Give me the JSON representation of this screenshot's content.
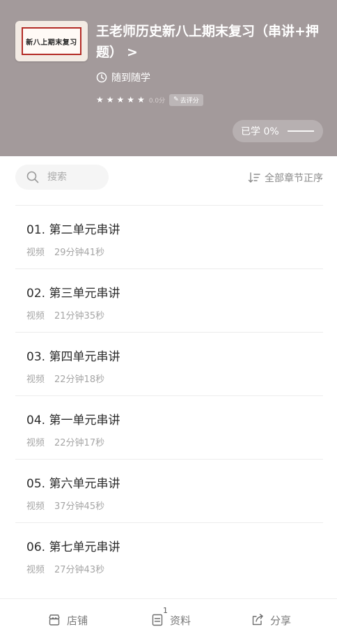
{
  "header": {
    "thumbnail_text": "新八上期末复习",
    "title": "王老师历史新八上期末复习（串讲+押题）",
    "title_chevron": ">",
    "study_mode": "随到随学",
    "rating_text": "0.0分",
    "rate_button": "去评分",
    "progress_label": "已学 0%",
    "progress_value": 0,
    "colors": {
      "header_bg": "#a39a9b",
      "thumb_border": "#b32b25"
    }
  },
  "toolbar": {
    "search_placeholder": "搜索",
    "sort_label": "全部章节正序"
  },
  "chapters": [
    {
      "title": "01. 第二单元串讲",
      "type": "视频",
      "duration": "29分钟41秒"
    },
    {
      "title": "02. 第三单元串讲",
      "type": "视频",
      "duration": "21分钟35秒"
    },
    {
      "title": "03. 第四单元串讲",
      "type": "视频",
      "duration": "22分钟18秒"
    },
    {
      "title": "04. 第一单元串讲",
      "type": "视频",
      "duration": "22分钟17秒"
    },
    {
      "title": "05. 第六单元串讲",
      "type": "视频",
      "duration": "37分钟45秒"
    },
    {
      "title": "06. 第七单元串讲",
      "type": "视频",
      "duration": "27分钟43秒"
    }
  ],
  "bottom_bar": {
    "shop_label": "店铺",
    "materials_label": "资料",
    "materials_badge": "1",
    "share_label": "分享",
    "icons": [
      "shop-icon",
      "document-icon",
      "share-icon"
    ]
  }
}
